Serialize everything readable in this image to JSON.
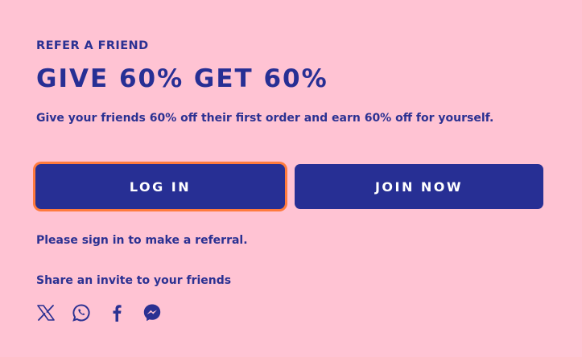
{
  "refer": {
    "eyebrow": "REFER A FRIEND",
    "headline": "GIVE 60% GET 60%",
    "subtext": "Give your friends 60% off their first order and earn 60% off for yourself."
  },
  "buttons": {
    "login_label": "LOG IN",
    "join_label": "JOIN NOW"
  },
  "signin_note": "Please sign in to make a referral.",
  "share": {
    "label": "Share an invite to your friends",
    "icons": [
      "x-icon",
      "whatsapp-icon",
      "facebook-icon",
      "messenger-icon"
    ]
  },
  "colors": {
    "background": "#ffc3d3",
    "primary": "#272f94",
    "focus_ring": "#ff7a3d"
  }
}
